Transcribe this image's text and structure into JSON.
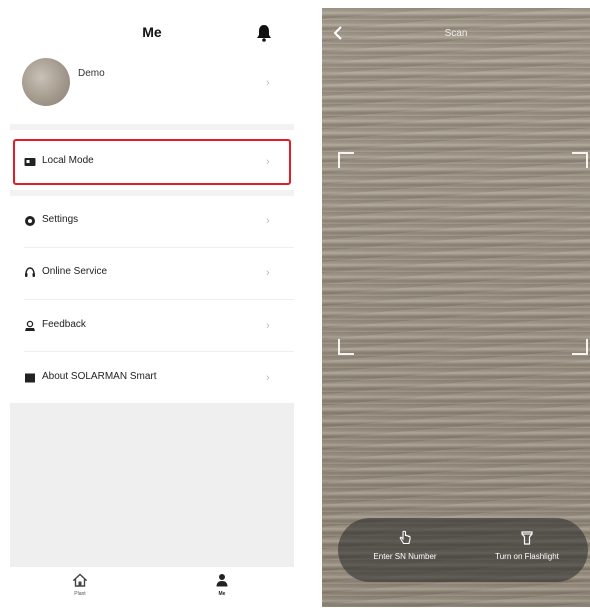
{
  "left_screen": {
    "title": "Me",
    "profile": {
      "name": "Demo"
    },
    "menu": [
      {
        "id": "local-mode",
        "label": "Local Mode",
        "icon": "local-mode-icon"
      },
      {
        "id": "settings",
        "label": "Settings",
        "icon": "gear-icon"
      },
      {
        "id": "online-service",
        "label": "Online Service",
        "icon": "headset-icon"
      },
      {
        "id": "feedback",
        "label": "Feedback",
        "icon": "feedback-icon"
      },
      {
        "id": "about",
        "label": "About SOLARMAN Smart",
        "icon": "book-icon"
      }
    ],
    "tabbar": {
      "plant_label": "Plant",
      "me_label": "Me"
    },
    "highlight_color": "#e31c23"
  },
  "right_screen": {
    "title": "Scan",
    "actions": {
      "enter_sn_label": "Enter SN Number",
      "flashlight_label": "Turn on Flashlight"
    }
  }
}
